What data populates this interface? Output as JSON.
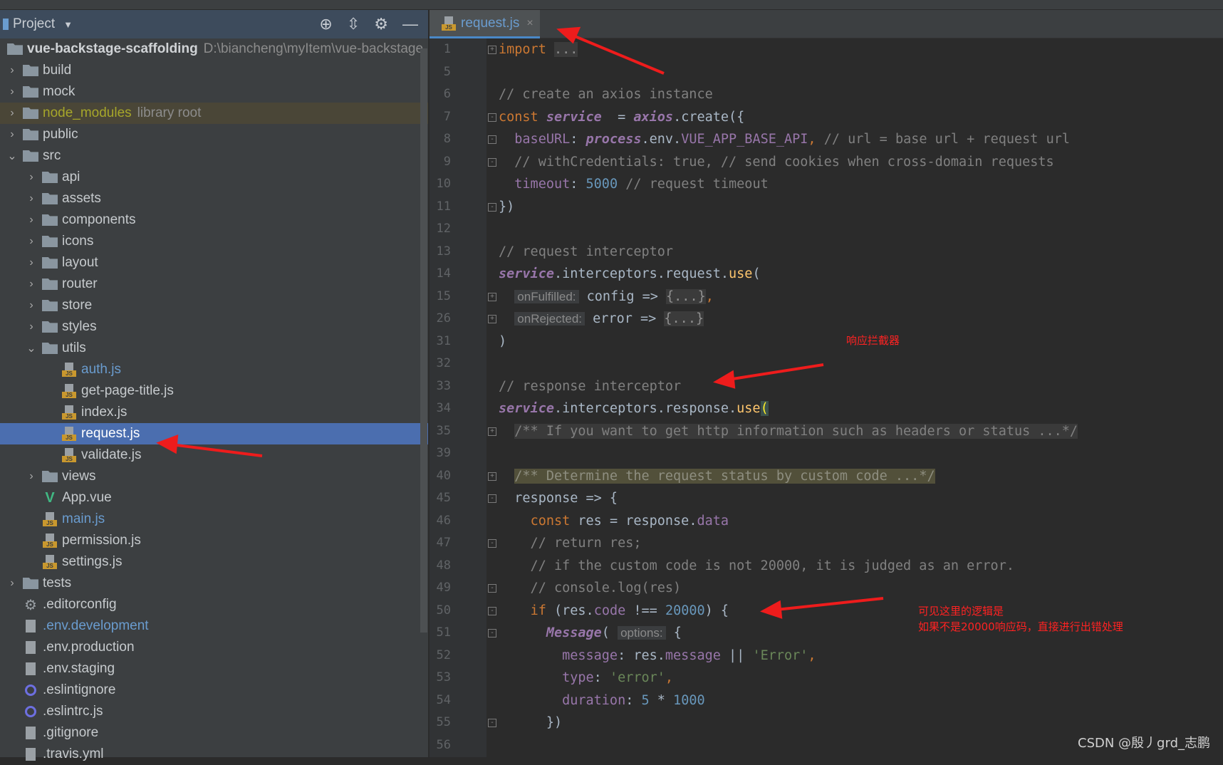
{
  "sidebar": {
    "title": "Project",
    "root": {
      "name": "vue-backstage-scaffolding",
      "path": "D:\\biancheng\\myItem\\vue-backstage"
    },
    "items": [
      {
        "name": "build",
        "depth": 0,
        "icon": "folder",
        "arrow": "›"
      },
      {
        "name": "mock",
        "depth": 0,
        "icon": "folder",
        "arrow": "›"
      },
      {
        "name": "node_modules",
        "depth": 0,
        "icon": "folder",
        "arrow": "›",
        "note": "library root",
        "color": "#a6a62a",
        "state": "lib"
      },
      {
        "name": "public",
        "depth": 0,
        "icon": "folder",
        "arrow": "›"
      },
      {
        "name": "src",
        "depth": 0,
        "icon": "folder",
        "arrow": "⌄"
      },
      {
        "name": "api",
        "depth": 1,
        "icon": "folder",
        "arrow": "›"
      },
      {
        "name": "assets",
        "depth": 1,
        "icon": "folder",
        "arrow": "›"
      },
      {
        "name": "components",
        "depth": 1,
        "icon": "folder",
        "arrow": "›"
      },
      {
        "name": "icons",
        "depth": 1,
        "icon": "folder",
        "arrow": "›"
      },
      {
        "name": "layout",
        "depth": 1,
        "icon": "folder",
        "arrow": "›"
      },
      {
        "name": "router",
        "depth": 1,
        "icon": "folder",
        "arrow": "›"
      },
      {
        "name": "store",
        "depth": 1,
        "icon": "folder",
        "arrow": "›"
      },
      {
        "name": "styles",
        "depth": 1,
        "icon": "folder",
        "arrow": "›"
      },
      {
        "name": "utils",
        "depth": 1,
        "icon": "folder",
        "arrow": "⌄"
      },
      {
        "name": "auth.js",
        "depth": 2,
        "icon": "js",
        "color": "#6a9ccf"
      },
      {
        "name": "get-page-title.js",
        "depth": 2,
        "icon": "js"
      },
      {
        "name": "index.js",
        "depth": 2,
        "icon": "js"
      },
      {
        "name": "request.js",
        "depth": 2,
        "icon": "js",
        "state": "sel"
      },
      {
        "name": "validate.js",
        "depth": 2,
        "icon": "js"
      },
      {
        "name": "views",
        "depth": 1,
        "icon": "folder",
        "arrow": "›"
      },
      {
        "name": "App.vue",
        "depth": 1,
        "icon": "vue"
      },
      {
        "name": "main.js",
        "depth": 1,
        "icon": "js",
        "color": "#6a9ccf"
      },
      {
        "name": "permission.js",
        "depth": 1,
        "icon": "js"
      },
      {
        "name": "settings.js",
        "depth": 1,
        "icon": "js"
      },
      {
        "name": "tests",
        "depth": 0,
        "icon": "folder",
        "arrow": "›"
      },
      {
        "name": ".editorconfig",
        "depth": 0,
        "icon": "gear"
      },
      {
        "name": ".env.development",
        "depth": 0,
        "icon": "file",
        "color": "#6a9ccf"
      },
      {
        "name": ".env.production",
        "depth": 0,
        "icon": "file"
      },
      {
        "name": ".env.staging",
        "depth": 0,
        "icon": "file"
      },
      {
        "name": ".eslintignore",
        "depth": 0,
        "icon": "eslint"
      },
      {
        "name": ".eslintrc.js",
        "depth": 0,
        "icon": "eslint"
      },
      {
        "name": ".gitignore",
        "depth": 0,
        "icon": "file"
      },
      {
        "name": ".travis.yml",
        "depth": 0,
        "icon": "file"
      }
    ]
  },
  "tab": {
    "label": "request.js",
    "close": "×"
  },
  "code": [
    {
      "n": "1",
      "fold": "+",
      "t": [
        [
          "kw",
          "import "
        ],
        [
          "fold",
          "..."
        ]
      ]
    },
    {
      "n": "5",
      "t": []
    },
    {
      "n": "6",
      "t": [
        [
          "cm",
          "// create an axios instance"
        ]
      ]
    },
    {
      "n": "7",
      "fold": "-",
      "t": [
        [
          "kw",
          "const "
        ],
        [
          "obj",
          "service"
        ],
        [
          "",
          "  = "
        ],
        [
          "obj",
          "axios"
        ],
        [
          "",
          ".create({"
        ]
      ]
    },
    {
      "n": "8",
      "fold": "-",
      "t": [
        [
          "",
          "  "
        ],
        [
          "prop",
          "baseURL"
        ],
        [
          "",
          ": "
        ],
        [
          "obj",
          "process"
        ],
        [
          "",
          ".env."
        ],
        [
          "prop",
          "VUE_APP_BASE_API"
        ],
        [
          "kw",
          ", "
        ],
        [
          "cm",
          "// url = base url + request url"
        ]
      ]
    },
    {
      "n": "9",
      "fold": "-",
      "t": [
        [
          "cm",
          "  // withCredentials: true, // send cookies when cross-domain requests"
        ]
      ]
    },
    {
      "n": "10",
      "t": [
        [
          "",
          "  "
        ],
        [
          "prop",
          "timeout"
        ],
        [
          "",
          ": "
        ],
        [
          "num",
          "5000"
        ],
        [
          "cm",
          " // request timeout"
        ]
      ]
    },
    {
      "n": "11",
      "fold": "-",
      "t": [
        [
          "",
          "})"
        ]
      ]
    },
    {
      "n": "12",
      "t": []
    },
    {
      "n": "13",
      "t": [
        [
          "cm",
          "// request interceptor"
        ]
      ]
    },
    {
      "n": "14",
      "t": [
        [
          "obj",
          "service"
        ],
        [
          "",
          ".interceptors.request."
        ],
        [
          "fn",
          "use"
        ],
        [
          "",
          "("
        ]
      ]
    },
    {
      "n": "15",
      "fold": "+",
      "t": [
        [
          "",
          "  "
        ],
        [
          "hint",
          "onFulfilled:"
        ],
        [
          "",
          " config => "
        ],
        [
          "fold",
          "{...}"
        ],
        [
          "kw",
          ","
        ]
      ]
    },
    {
      "n": "26",
      "fold": "+",
      "t": [
        [
          "",
          "  "
        ],
        [
          "hint",
          "onRejected:"
        ],
        [
          "",
          " error => "
        ],
        [
          "fold",
          "{...}"
        ]
      ]
    },
    {
      "n": "31",
      "t": [
        [
          "",
          ")"
        ]
      ]
    },
    {
      "n": "32",
      "t": []
    },
    {
      "n": "33",
      "t": [
        [
          "cm",
          "// response interceptor"
        ]
      ]
    },
    {
      "n": "34",
      "t": [
        [
          "obj",
          "service"
        ],
        [
          "",
          ".interceptors.response."
        ],
        [
          "fn",
          "use"
        ],
        [
          "paren",
          "("
        ]
      ]
    },
    {
      "n": "35",
      "fold": "+",
      "t": [
        [
          "",
          "  "
        ],
        [
          "cmbox",
          "/** If you want to get http information such as headers or status ...*/"
        ]
      ]
    },
    {
      "n": "39",
      "t": []
    },
    {
      "n": "40",
      "fold": "+",
      "t": [
        [
          "",
          "  "
        ],
        [
          "cmhl",
          "/** Determine the request status by custom code ...*/"
        ]
      ]
    },
    {
      "n": "45",
      "fold": "-",
      "t": [
        [
          "",
          "  response => {"
        ]
      ]
    },
    {
      "n": "46",
      "t": [
        [
          "",
          "    "
        ],
        [
          "kw",
          "const "
        ],
        [
          "",
          "res = response."
        ],
        [
          "prop",
          "data"
        ]
      ]
    },
    {
      "n": "47",
      "fold": "-",
      "t": [
        [
          "cm",
          "    // return res;"
        ]
      ]
    },
    {
      "n": "48",
      "t": [
        [
          "cm",
          "    // if the custom code is not 20000, it is judged as an error."
        ]
      ]
    },
    {
      "n": "49",
      "fold": "-",
      "t": [
        [
          "cm",
          "    // console.log(res)"
        ]
      ]
    },
    {
      "n": "50",
      "fold": "-",
      "t": [
        [
          "",
          "    "
        ],
        [
          "kw",
          "if "
        ],
        [
          "",
          "(res."
        ],
        [
          "prop",
          "code"
        ],
        [
          "",
          " !== "
        ],
        [
          "num",
          "20000"
        ],
        [
          "",
          ") {"
        ]
      ]
    },
    {
      "n": "51",
      "fold": "-",
      "t": [
        [
          "",
          "      "
        ],
        [
          "obj",
          "Message"
        ],
        [
          "",
          "( "
        ],
        [
          "hint",
          "options:"
        ],
        [
          "",
          " {"
        ]
      ]
    },
    {
      "n": "52",
      "t": [
        [
          "",
          "        "
        ],
        [
          "prop",
          "message"
        ],
        [
          "",
          ": res."
        ],
        [
          "prop",
          "message"
        ],
        [
          "",
          " || "
        ],
        [
          "str",
          "'Error'"
        ],
        [
          "kw",
          ","
        ]
      ]
    },
    {
      "n": "53",
      "t": [
        [
          "",
          "        "
        ],
        [
          "prop",
          "type"
        ],
        [
          "",
          ": "
        ],
        [
          "str",
          "'error'"
        ],
        [
          "kw",
          ","
        ]
      ]
    },
    {
      "n": "54",
      "t": [
        [
          "",
          "        "
        ],
        [
          "prop",
          "duration"
        ],
        [
          "",
          ": "
        ],
        [
          "num",
          "5"
        ],
        [
          "",
          " * "
        ],
        [
          "num",
          "1000"
        ]
      ]
    },
    {
      "n": "55",
      "fold": "-",
      "t": [
        [
          "",
          "      })"
        ]
      ]
    },
    {
      "n": "56",
      "t": []
    }
  ],
  "annotations": {
    "response_interceptor": "响应拦截器",
    "logic_line1": "可见这里的逻辑是",
    "logic_line2": "如果不是20000响应码，直接进行出错处理",
    "color": "#ff2222"
  },
  "watermark": "CSDN @殷丿grd_志鹏"
}
